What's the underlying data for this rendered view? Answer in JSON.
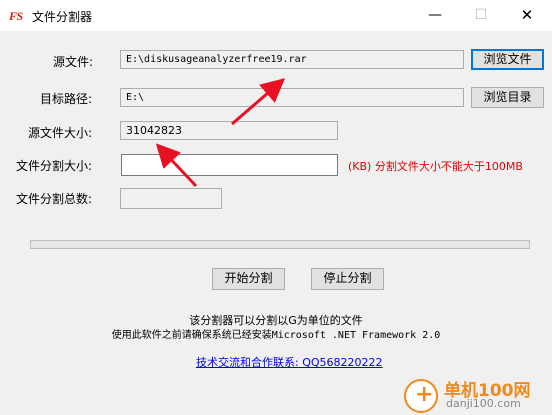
{
  "window": {
    "icon_text": "FS",
    "title": "文件分割器",
    "min": "—",
    "max": "☐",
    "close": "✕"
  },
  "form": {
    "source_label": "源文件:",
    "source_value": "E:\\diskusageanalyzerfree19.rar",
    "browse_file": "浏览文件",
    "target_label": "目标路径:",
    "target_value": "E:\\",
    "browse_dir": "浏览目录",
    "size_label": "源文件大小:",
    "size_value": "31042823",
    "split_size_label": "文件分割大小:",
    "split_size_value": "",
    "split_hint": "(KB) 分割文件大小不能大于100MB",
    "total_label": "文件分割总数:",
    "total_value": ""
  },
  "progress": {
    "value": 0
  },
  "actions": {
    "start": "开始分割",
    "stop": "停止分割"
  },
  "info": {
    "line1": "该分割器可以分割以G为单位的文件",
    "line2": "使用此软件之前请确保系统已经安装Microsoft .NET Framework 2.0",
    "link": "技术交流和合作联系: QQ568220222"
  },
  "watermark": {
    "brand": "单机100网",
    "domain": "danji100.com"
  },
  "colors": {
    "accent": "#0078d7",
    "hint": "#e60000",
    "arrow": "#e81123",
    "link": "#0000ee"
  }
}
